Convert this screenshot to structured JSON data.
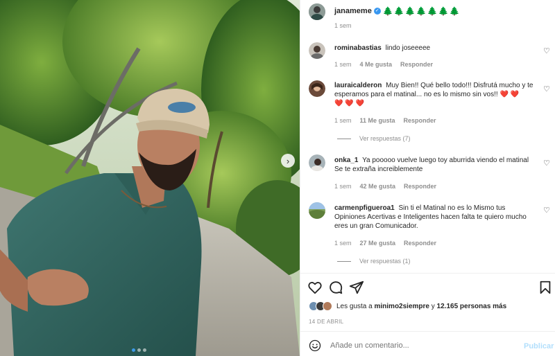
{
  "post": {
    "author": "janameme",
    "author_suffix": "🌲🌲🌲🌲🌲🌲🌲",
    "time": "1 sem"
  },
  "comments": [
    {
      "user": "rominabastias",
      "text": "lindo joseeeee",
      "time": "1 sem",
      "likes": "4 Me gusta",
      "reply": "Responder"
    },
    {
      "user": "lauraicalderon",
      "text": "Muy Bien!! Qué bello todo!!! Disfrutá mucho y te esperamos para el matinal... no es lo mismo sin vos!!",
      "hearts_inline": "❤️ ❤️",
      "hearts_line": "❤️ ❤️ ❤️",
      "time": "1 sem",
      "likes": "11 Me gusta",
      "reply": "Responder",
      "view_replies": "Ver respuestas (7)"
    },
    {
      "user": "onka_1",
      "text": "Ya pooooo vuelve luego toy aburrida viendo el matinal Se te extraña increiblemente",
      "time": "1 sem",
      "likes": "42 Me gusta",
      "reply": "Responder"
    },
    {
      "user": "carmenpfigueroa1",
      "text": "Sin ti el Matinal no es lo Mismo tus Opiniones Acertivas e Inteligentes hacen falta te quiero mucho eres un gran Comunicador.",
      "time": "1 sem",
      "likes": "27 Me gusta",
      "reply": "Responder",
      "view_replies": "Ver respuestas (1)"
    }
  ],
  "likes": {
    "prefix": "Les gusta a",
    "user": "minimo2siempre",
    "middle": "y",
    "count": "12.165 personas más"
  },
  "date": "14 DE ABRIL",
  "comment_box": {
    "placeholder": "Añade un comentario...",
    "publish": "Publicar"
  },
  "icons": {
    "like": "heart-outline-icon",
    "comment": "comment-bubble-icon",
    "share": "paper-plane-icon",
    "save": "bookmark-icon",
    "emoji": "smiley-icon",
    "next": "chevron-right-icon",
    "verified": "verified-badge-icon"
  },
  "colors": {
    "link_blue": "#3897f0",
    "publish_disabled": "#b2dffc",
    "muted": "#8e8e8e",
    "text": "#262626",
    "carousel_active_dot": "#3d9ae8"
  },
  "carousel": {
    "slides": 3,
    "active": 1
  }
}
